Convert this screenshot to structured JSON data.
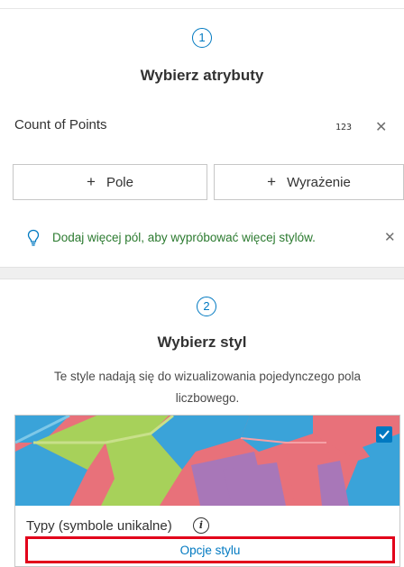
{
  "step1": {
    "number": "1",
    "title": "Wybierz atrybuty",
    "attribute": {
      "label": "Count of Points",
      "type_icon_text": "123",
      "remove_glyph": "✕"
    },
    "buttons": {
      "field_plus": "+",
      "field_label": "Pole",
      "expression_plus": "+",
      "expression_label": "Wyrażenie"
    },
    "hint": {
      "icon": "lightbulb-icon",
      "text": "Dodaj więcej pól, aby wypróbować więcej stylów.",
      "close_glyph": "✕"
    }
  },
  "step2": {
    "number": "2",
    "title": "Wybierz styl",
    "description_line1": "Te style nadają się do wizualizowania pojedynczego pola",
    "description_line2": "liczbowego.",
    "style_card": {
      "title": "Typy (symbole unikalne)",
      "info_glyph": "i",
      "selected": true,
      "options_button": "Opcje stylu"
    }
  },
  "colors": {
    "accent_blue": "#0079c1",
    "hint_green": "#2b7a2f",
    "highlight_red": "#e2001a",
    "map_pink": "#e8717a",
    "map_blue": "#3aa3d9",
    "map_green": "#a7d15a",
    "map_purple": "#a877b8"
  }
}
